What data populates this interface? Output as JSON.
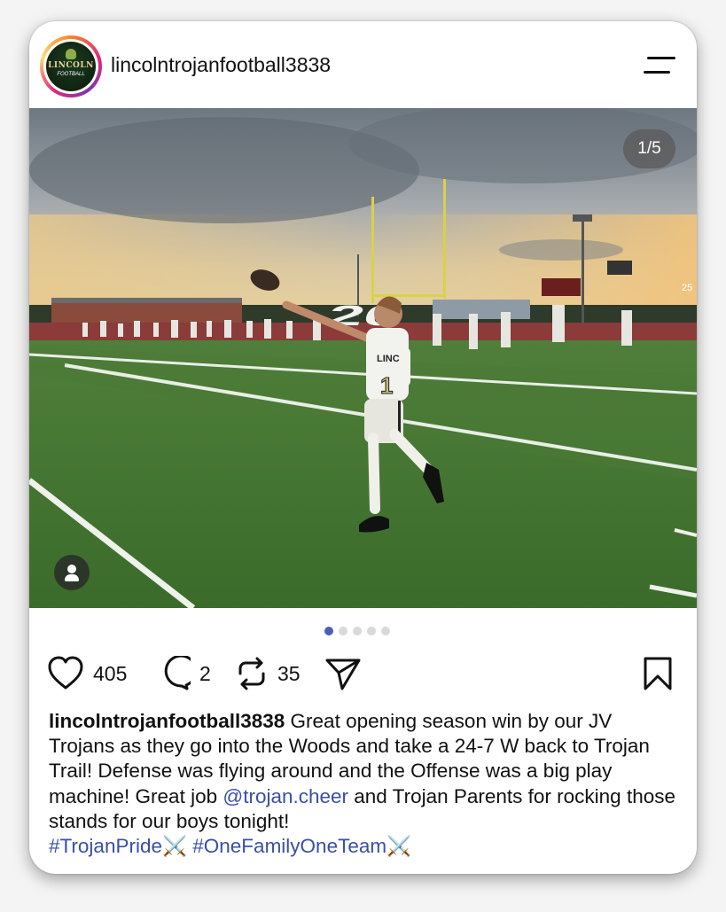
{
  "post": {
    "username": "lincolntrojanfootball3838",
    "avatar": {
      "logo_text": "LINCOLN",
      "logo_sub": "FOOTBALL"
    },
    "media": {
      "counter": "1/5",
      "field_number": "20",
      "scoreboard_text": "25",
      "jersey_text": "LINCO",
      "jersey_number": "1"
    },
    "carousel": {
      "total": 5,
      "active": 1
    },
    "actions": {
      "likes": "405",
      "comments": "2",
      "reposts": "35"
    },
    "caption": {
      "username": "lincolntrojanfootball3838",
      "text_1": " Great opening season win by our JV Trojans as they go into the Woods and take a 24-7 W back to Trojan Trail! Defense was flying around and the Offense was a big play machine! Great job ",
      "mention": "@trojan.cheer",
      "text_2": " and Trojan Parents for rocking those stands for our boys tonight!",
      "hashtag_1": "#TrojanPride",
      "emoji_1": "⚔️",
      "hashtag_2": "#OneFamilyOneTeam",
      "emoji_2": "⚔️"
    }
  },
  "colors": {
    "link": "#3a4fa8",
    "dot_active": "#4a5fb8",
    "dot_inactive": "#d9d9d9"
  }
}
